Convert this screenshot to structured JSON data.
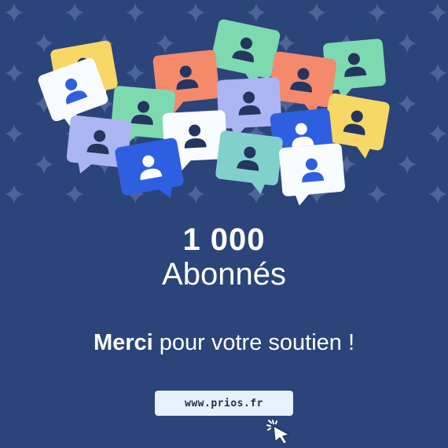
{
  "count": "1 000",
  "label": "Abonnés",
  "thanks": {
    "strong": "Merci",
    "rest": " pour votre soutien !"
  },
  "url": "www.prios.fr",
  "icons": {
    "bubble": "user-chat-bubble-icon",
    "cursor": "click-cursor-icon",
    "sparkle": "sparkle-star-icon"
  },
  "colors": {
    "background": "#2b4479",
    "sparkle": "#4e6499",
    "text": "#ffffff",
    "button": "#e6f1fb",
    "buttonText": "#22314f",
    "bubbles": [
      "#f8fbff",
      "#f7d766",
      "#7dd9b0",
      "#f4896c",
      "#aab5f2",
      "#2e5fe0",
      "#81d0cc"
    ],
    "userDark": "#24355f",
    "userBlue": "#2e5fe0",
    "userWhite": "#ffffff"
  }
}
